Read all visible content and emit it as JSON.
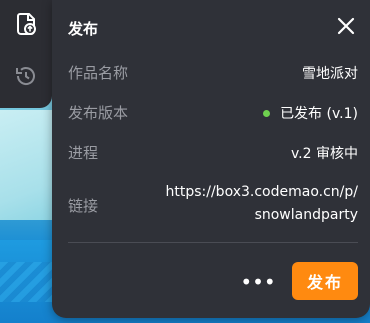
{
  "panel": {
    "title": "发布",
    "rows": {
      "name": {
        "label": "作品名称",
        "value": "雪地派对"
      },
      "version": {
        "label": "发布版本",
        "value": "已发布 (v.1)",
        "status_color": "#6fd14f"
      },
      "progress": {
        "label": "进程",
        "value": "v.2 审核中"
      },
      "link": {
        "label": "链接",
        "value_line1": "https://box3.codemao.cn/p/",
        "value_line2": "snowlandparty"
      }
    },
    "more_label": "•••",
    "publish_label": "发布"
  },
  "toolbar": {
    "items": [
      {
        "icon": "publish-doc-icon"
      },
      {
        "icon": "history-clock-icon"
      }
    ]
  },
  "colors": {
    "panel_bg": "#2f3138",
    "accent": "#ff8a10",
    "label": "#9a9ca3"
  }
}
